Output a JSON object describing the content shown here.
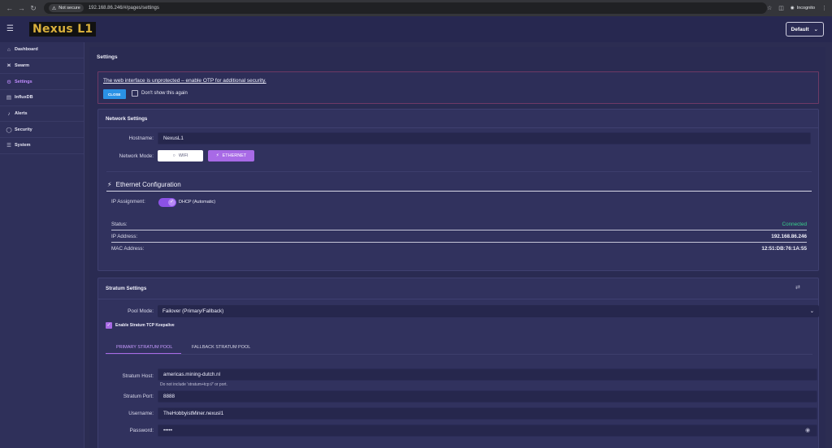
{
  "browser": {
    "not_secure": "Not secure",
    "url": "192.168.86.246/#/pages/settings",
    "incognito": "Incognito"
  },
  "header": {
    "brand": "Nexus L1",
    "theme": "Default"
  },
  "sidebar": {
    "items": [
      {
        "label": "Dashboard",
        "icon": "home-icon"
      },
      {
        "label": "Swarm",
        "icon": "share-icon"
      },
      {
        "label": "Settings",
        "icon": "gear-icon"
      },
      {
        "label": "InfluxDB",
        "icon": "database-icon"
      },
      {
        "label": "Alerts",
        "icon": "bell-icon"
      },
      {
        "label": "Security",
        "icon": "shield-icon"
      },
      {
        "label": "System",
        "icon": "server-icon"
      }
    ],
    "active": "Settings"
  },
  "page": {
    "title": "Settings"
  },
  "alert": {
    "message": "The web interface is unprotected – enable OTP for additional security.",
    "close_label": "CLOSE",
    "dont_show_label": "Don't show this again"
  },
  "network": {
    "title": "Network Settings",
    "hostname_label": "Hostname:",
    "hostname": "NexusL1",
    "mode_label": "Network Mode:",
    "wifi_label": "WIFI",
    "ethernet_label": "ETHERNET",
    "ethernet_title": "Ethernet Configuration",
    "ip_assignment_label": "IP Assignment:",
    "ip_assignment_value": "DHCP (Automatic)",
    "status_label": "Status:",
    "status_value": "Connected",
    "ip_label": "IP Address:",
    "ip_value": "192.168.86.246",
    "mac_label": "MAC Address:",
    "mac_value": "12:51:DB:76:1A:55"
  },
  "stratum": {
    "title": "Stratum Settings",
    "pool_mode_label": "Pool Mode:",
    "pool_mode": "Failover (Primary/Fallback)",
    "keepalive_label": "Enable Stratum TCP Keepalive",
    "tab_primary": "PRIMARY STRATUM POOL",
    "tab_fallback": "FALLBACK STRATUM POOL",
    "host_label": "Stratum Host:",
    "host": "americas.mining-dutch.nl",
    "host_hint": "Do not include 'stratum+tcp://' or port.",
    "port_label": "Stratum Port:",
    "port": "8888",
    "username_label": "Username:",
    "username": "TheHobbyistMiner.nexusl1",
    "password_label": "Password:",
    "password": "•••••"
  },
  "colors": {
    "accent": "#a86ae6",
    "success": "#38d38c",
    "close_button": "#2a92e6",
    "brand_text": "#d9b03c"
  }
}
